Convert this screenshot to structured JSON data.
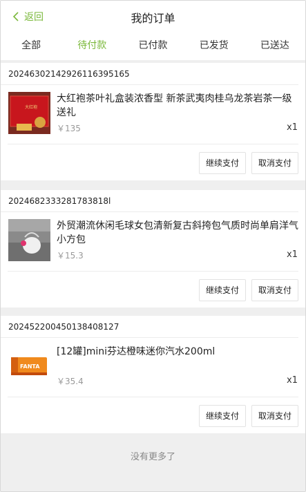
{
  "header": {
    "back_label": "返回",
    "title": "我的订单"
  },
  "tabs": [
    {
      "label": "全部",
      "active": false
    },
    {
      "label": "待付款",
      "active": true
    },
    {
      "label": "已付款",
      "active": false
    },
    {
      "label": "已发货",
      "active": false
    },
    {
      "label": "已送达",
      "active": false
    }
  ],
  "orders": [
    {
      "order_no": "20246302142926116395165",
      "item_name": "大红袍茶叶礼盒装浓香型 新茶武夷肉桂乌龙茶岩茶一级送礼",
      "price": "￥135",
      "qty": "x1",
      "pay_label": "继续支付",
      "cancel_label": "取消支付"
    },
    {
      "order_no": "2024682333281783818l",
      "item_name": "外贸潮流休闲毛球女包清新复古斜挎包气质时尚单肩洋气小方包",
      "price": "￥15.3",
      "qty": "x1",
      "pay_label": "继续支付",
      "cancel_label": "取消支付"
    },
    {
      "order_no": "20245220045013840812​7",
      "item_name": "[12罐]mini芬达橙味迷你汽水200ml",
      "price": "￥35.4",
      "qty": "x1",
      "pay_label": "继续支付",
      "cancel_label": "取消支付"
    }
  ],
  "footer": {
    "no_more": "没有更多了"
  },
  "colors": {
    "accent": "#7ab83a",
    "background": "#efefef"
  }
}
